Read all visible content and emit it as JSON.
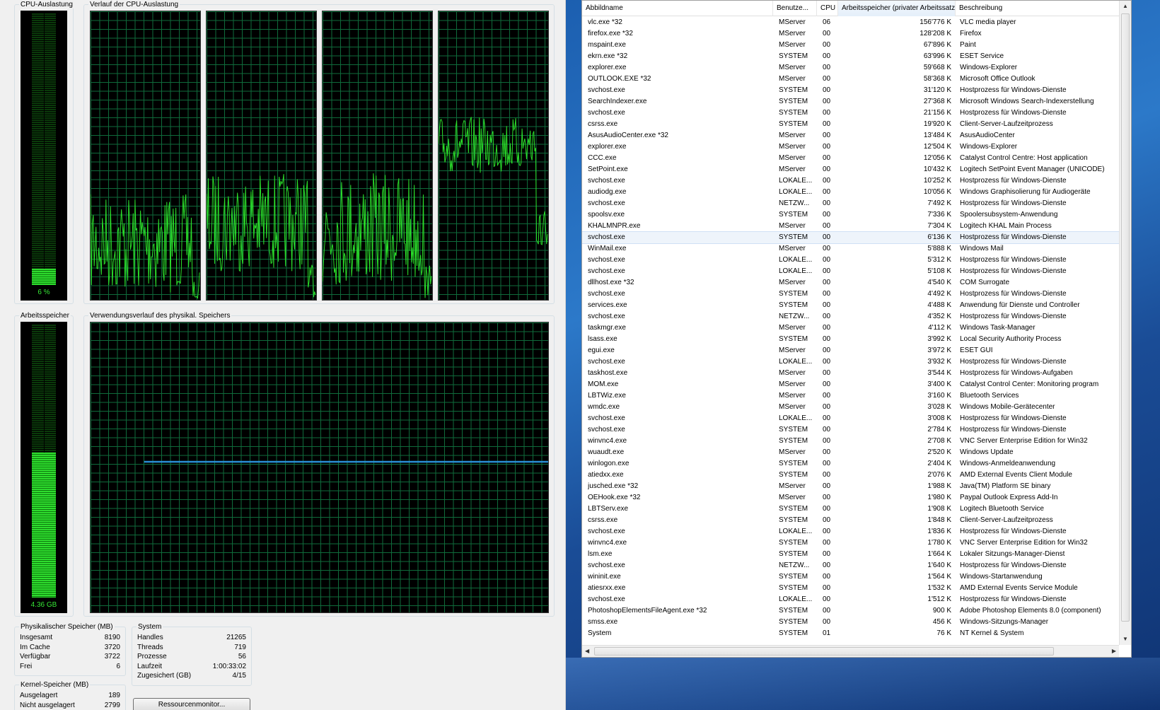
{
  "perf": {
    "cpu_label": "CPU-Auslastung",
    "cpu_value": "6 %",
    "cpu_percent": 6,
    "cpu_history_label": "Verlauf der CPU-Auslastung",
    "mem_label": "Arbeitsspeicher",
    "mem_value": "4.36 GB",
    "mem_fraction": 0.53,
    "mem_history_label": "Verwendungsverlauf des physikal. Speichers",
    "physical": {
      "title": "Physikalischer Speicher (MB)",
      "rows": [
        {
          "label": "Insgesamt",
          "value": "8190"
        },
        {
          "label": "Im Cache",
          "value": "3720"
        },
        {
          "label": "Verfügbar",
          "value": "3722"
        },
        {
          "label": "Frei",
          "value": "6"
        }
      ]
    },
    "system": {
      "title": "System",
      "rows": [
        {
          "label": "Handles",
          "value": "21265"
        },
        {
          "label": "Threads",
          "value": "719"
        },
        {
          "label": "Prozesse",
          "value": "56"
        },
        {
          "label": "Laufzeit",
          "value": "1:00:33:02"
        },
        {
          "label": "Zugesichert (GB)",
          "value": "4/15"
        }
      ]
    },
    "kernel": {
      "title": "Kernel-Speicher (MB)",
      "rows": [
        {
          "label": "Ausgelagert",
          "value": "189"
        },
        {
          "label": "Nicht ausgelagert",
          "value": "2799"
        }
      ]
    },
    "resource_button": "Ressourcenmonitor..."
  },
  "processes": {
    "columns": [
      "Abbildname",
      "Benutze...",
      "CPU",
      "Arbeitsspeicher (privater Arbeitssatz)",
      "Beschreibung"
    ],
    "rows": [
      [
        "vlc.exe *32",
        "MServer",
        "06",
        "156'776 K",
        "VLC media player"
      ],
      [
        "firefox.exe *32",
        "MServer",
        "00",
        "128'208 K",
        "Firefox"
      ],
      [
        "mspaint.exe",
        "MServer",
        "00",
        "67'896 K",
        "Paint"
      ],
      [
        "ekrn.exe *32",
        "SYSTEM",
        "00",
        "63'996 K",
        "ESET Service"
      ],
      [
        "explorer.exe",
        "MServer",
        "00",
        "59'668 K",
        "Windows-Explorer"
      ],
      [
        "OUTLOOK.EXE *32",
        "MServer",
        "00",
        "58'368 K",
        "Microsoft Office Outlook"
      ],
      [
        "svchost.exe",
        "SYSTEM",
        "00",
        "31'120 K",
        "Hostprozess für Windows-Dienste"
      ],
      [
        "SearchIndexer.exe",
        "SYSTEM",
        "00",
        "27'368 K",
        "Microsoft Windows Search-Indexerstellung"
      ],
      [
        "svchost.exe",
        "SYSTEM",
        "00",
        "21'156 K",
        "Hostprozess für Windows-Dienste"
      ],
      [
        "csrss.exe",
        "SYSTEM",
        "00",
        "19'920 K",
        "Client-Server-Laufzeitprozess"
      ],
      [
        "AsusAudioCenter.exe *32",
        "MServer",
        "00",
        "13'484 K",
        "AsusAudioCenter"
      ],
      [
        "explorer.exe",
        "MServer",
        "00",
        "12'504 K",
        "Windows-Explorer"
      ],
      [
        "CCC.exe",
        "MServer",
        "00",
        "12'056 K",
        "Catalyst Control Centre: Host application"
      ],
      [
        "SetPoint.exe",
        "MServer",
        "00",
        "10'432 K",
        "Logitech SetPoint Event Manager (UNICODE)"
      ],
      [
        "svchost.exe",
        "LOKALE...",
        "00",
        "10'252 K",
        "Hostprozess für Windows-Dienste"
      ],
      [
        "audiodg.exe",
        "LOKALE...",
        "00",
        "10'056 K",
        "Windows Graphisolierung für Audiogeräte"
      ],
      [
        "svchost.exe",
        "NETZW...",
        "00",
        "7'492 K",
        "Hostprozess für Windows-Dienste"
      ],
      [
        "spoolsv.exe",
        "SYSTEM",
        "00",
        "7'336 K",
        "Spoolersubsystem-Anwendung"
      ],
      [
        "KHALMNPR.exe",
        "MServer",
        "00",
        "7'304 K",
        "Logitech KHAL Main Process"
      ],
      [
        "svchost.exe",
        "SYSTEM",
        "00",
        "6'136 K",
        "Hostprozess für Windows-Dienste"
      ],
      [
        "WinMail.exe",
        "MServer",
        "00",
        "5'888 K",
        "Windows Mail"
      ],
      [
        "svchost.exe",
        "LOKALE...",
        "00",
        "5'312 K",
        "Hostprozess für Windows-Dienste"
      ],
      [
        "svchost.exe",
        "LOKALE...",
        "00",
        "5'108 K",
        "Hostprozess für Windows-Dienste"
      ],
      [
        "dllhost.exe *32",
        "MServer",
        "00",
        "4'540 K",
        "COM Surrogate"
      ],
      [
        "svchost.exe",
        "SYSTEM",
        "00",
        "4'492 K",
        "Hostprozess für Windows-Dienste"
      ],
      [
        "services.exe",
        "SYSTEM",
        "00",
        "4'488 K",
        "Anwendung für Dienste und Controller"
      ],
      [
        "svchost.exe",
        "NETZW...",
        "00",
        "4'352 K",
        "Hostprozess für Windows-Dienste"
      ],
      [
        "taskmgr.exe",
        "MServer",
        "00",
        "4'112 K",
        "Windows Task-Manager"
      ],
      [
        "lsass.exe",
        "SYSTEM",
        "00",
        "3'992 K",
        "Local Security Authority Process"
      ],
      [
        "egui.exe",
        "MServer",
        "00",
        "3'972 K",
        "ESET GUI"
      ],
      [
        "svchost.exe",
        "LOKALE...",
        "00",
        "3'932 K",
        "Hostprozess für Windows-Dienste"
      ],
      [
        "taskhost.exe",
        "MServer",
        "00",
        "3'544 K",
        "Hostprozess für Windows-Aufgaben"
      ],
      [
        "MOM.exe",
        "MServer",
        "00",
        "3'400 K",
        "Catalyst Control Center: Monitoring program"
      ],
      [
        "LBTWiz.exe",
        "MServer",
        "00",
        "3'160 K",
        "Bluetooth Services"
      ],
      [
        "wmdc.exe",
        "MServer",
        "00",
        "3'028 K",
        "Windows Mobile-Gerätecenter"
      ],
      [
        "svchost.exe",
        "LOKALE...",
        "00",
        "3'008 K",
        "Hostprozess für Windows-Dienste"
      ],
      [
        "svchost.exe",
        "SYSTEM",
        "00",
        "2'784 K",
        "Hostprozess für Windows-Dienste"
      ],
      [
        "winvnc4.exe",
        "SYSTEM",
        "00",
        "2'708 K",
        "VNC Server Enterprise Edition for Win32"
      ],
      [
        "wuaudt.exe",
        "MServer",
        "00",
        "2'520 K",
        "Windows Update"
      ],
      [
        "winlogon.exe",
        "SYSTEM",
        "00",
        "2'404 K",
        "Windows-Anmeldeanwendung"
      ],
      [
        "atiedxx.exe",
        "SYSTEM",
        "00",
        "2'076 K",
        "AMD External Events Client Module"
      ],
      [
        "jusched.exe *32",
        "MServer",
        "00",
        "1'988 K",
        "Java(TM) Platform SE binary"
      ],
      [
        "OEHook.exe *32",
        "MServer",
        "00",
        "1'980 K",
        "Paypal Outlook Express Add-In"
      ],
      [
        "LBTServ.exe",
        "SYSTEM",
        "00",
        "1'908 K",
        "Logitech Bluetooth Service"
      ],
      [
        "csrss.exe",
        "SYSTEM",
        "00",
        "1'848 K",
        "Client-Server-Laufzeitprozess"
      ],
      [
        "svchost.exe",
        "LOKALE...",
        "00",
        "1'836 K",
        "Hostprozess für Windows-Dienste"
      ],
      [
        "winvnc4.exe",
        "SYSTEM",
        "00",
        "1'780 K",
        "VNC Server Enterprise Edition for Win32"
      ],
      [
        "lsm.exe",
        "SYSTEM",
        "00",
        "1'664 K",
        "Lokaler Sitzungs-Manager-Dienst"
      ],
      [
        "svchost.exe",
        "NETZW...",
        "00",
        "1'640 K",
        "Hostprozess für Windows-Dienste"
      ],
      [
        "wininit.exe",
        "SYSTEM",
        "00",
        "1'564 K",
        "Windows-Startanwendung"
      ],
      [
        "atiesrxx.exe",
        "SYSTEM",
        "00",
        "1'532 K",
        "AMD External Events Service Module"
      ],
      [
        "svchost.exe",
        "LOKALE...",
        "00",
        "1'512 K",
        "Hostprozess für Windows-Dienste"
      ],
      [
        "PhotoshopElementsFileAgent.exe *32",
        "SYSTEM",
        "00",
        "900 K",
        "Adobe Photoshop Elements 8.0 (component)"
      ],
      [
        "smss.exe",
        "SYSTEM",
        "00",
        "456 K",
        "Windows-Sitzungs-Manager"
      ],
      [
        "System",
        "SYSTEM",
        "01",
        "76 K",
        "NT Kernel & System"
      ]
    ],
    "selected_index": 19
  },
  "colors": {
    "graph_line": "#2be02b",
    "mem_line": "#2a8fd6",
    "grid": "#0f6b3b"
  }
}
